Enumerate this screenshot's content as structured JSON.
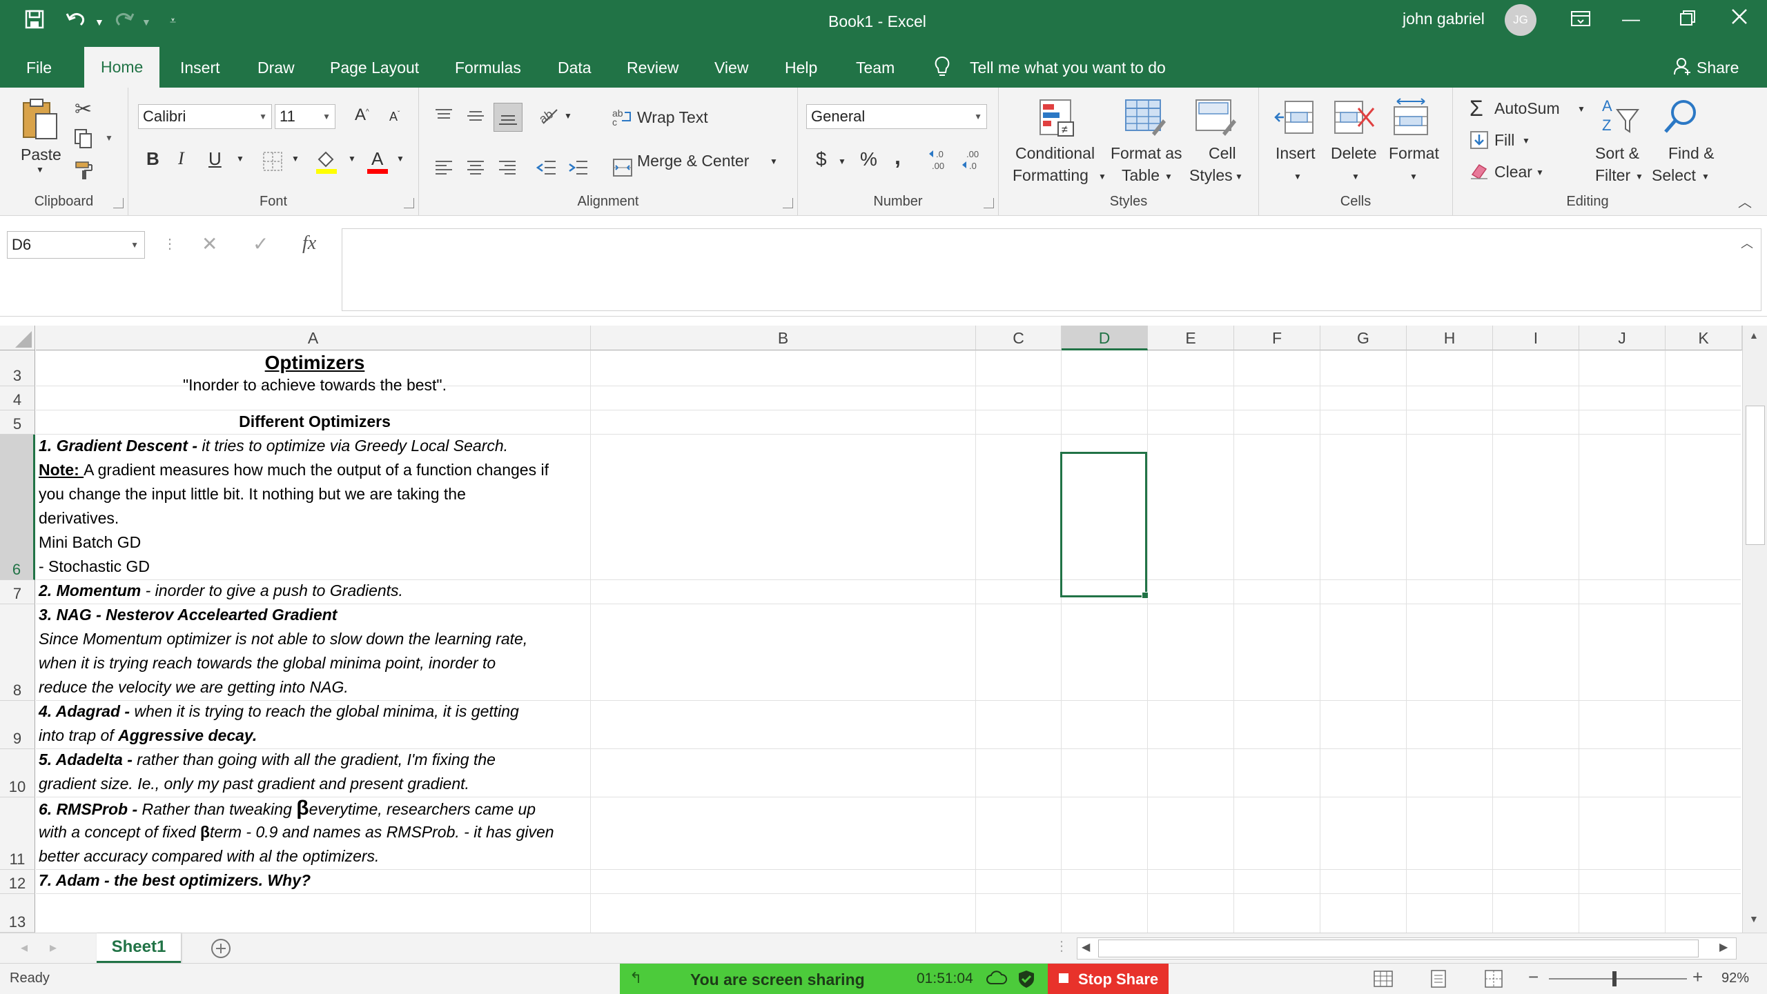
{
  "window": {
    "title": "Book1  -  Excel",
    "user": "john gabriel",
    "user_initials": "JG"
  },
  "tabs": [
    "File",
    "Home",
    "Insert",
    "Draw",
    "Page Layout",
    "Formulas",
    "Data",
    "Review",
    "View",
    "Help",
    "Team"
  ],
  "tell_me": "Tell me what you want to do",
  "share": "Share",
  "ribbon": {
    "clipboard": {
      "paste": "Paste",
      "label": "Clipboard"
    },
    "font": {
      "name": "Calibri",
      "size": "11",
      "label": "Font",
      "bold": "B",
      "italic": "I",
      "underline": "U"
    },
    "alignment": {
      "wrap": "Wrap Text",
      "merge": "Merge & Center",
      "label": "Alignment"
    },
    "number": {
      "format": "General",
      "currency": "$",
      "percent": "%",
      "comma": ",",
      "inc_dec": ".00",
      "label": "Number"
    },
    "styles": {
      "cond1": "Conditional",
      "cond2": "Formatting",
      "fmt1": "Format as",
      "fmt2": "Table",
      "cell1": "Cell",
      "cell2": "Styles",
      "label": "Styles"
    },
    "cells": {
      "insert": "Insert",
      "delete": "Delete",
      "format": "Format",
      "label": "Cells"
    },
    "editing": {
      "autosum": "AutoSum",
      "fill": "Fill",
      "clear": "Clear",
      "sort1": "Sort &",
      "sort2": "Filter",
      "find1": "Find &",
      "find2": "Select",
      "label": "Editing"
    }
  },
  "formula_bar": {
    "name_box": "D6",
    "fx": "fx",
    "value": ""
  },
  "columns": [
    "A",
    "B",
    "C",
    "D",
    "E",
    "F",
    "G",
    "H",
    "I",
    "J",
    "K"
  ],
  "rows": [
    "3",
    "4",
    "5",
    "6",
    "7",
    "8",
    "9",
    "10",
    "11",
    "12",
    "13"
  ],
  "cells": {
    "a2": "Optimizers",
    "a3": "\"Inorder to achieve towards the best\".",
    "a5": "Different Optimizers",
    "a6_l1_b": "1. Gradient Descent - ",
    "a6_l1": " it tries to optimize via Greedy Local Search.",
    "a6_l2_b": "Note: ",
    "a6_l2": "A gradient measures how much the output of a function changes if",
    "a6_l3": "you change the input little bit. It nothing but we are taking the",
    "a6_l4": "derivatives.",
    "a6_l5": " Mini Batch GD",
    "a6_l6": "- Stochastic GD",
    "a7_b": "2. Momentum ",
    "a7": " - inorder to give a push to Gradients.",
    "a8_l1": "3. NAG - Nesterov Accelearted Gradient",
    "a8_l2": "Since Momentum optimizer is not able to slow down the learning rate,",
    "a8_l3": "when it is trying reach towards the global minima point, inorder to",
    "a8_l4": "reduce the velocity we are getting into NAG.",
    "a9_b": "4. Adagrad - ",
    "a9_l1": " when it is trying to reach the global minima, it is getting",
    "a9_l2": "into trap of ",
    "a9_l2_b": "Aggressive decay.",
    "a10_b": "5. Adadelta - ",
    "a10_l1": " rather than going with all the gradient, I'm fixing the",
    "a10_l2": "gradient size. Ie., only my past gradient and present gradient.",
    "a11_b": "6. RMSProb - ",
    "a11_l1": " Rather than tweaking ",
    "a11_l1_rest": "everytime, researchers came up",
    "a11_l2": "with a concept of fixed ",
    "a11_l2_rest": "term - 0.9 and names as RMSProb. - it has given",
    "a11_l3": "better accuracy compared with al the optimizers.",
    "a12": "7. Adam - the best optimizers. Why?",
    "beta": "β"
  },
  "sheet_tab": "Sheet1",
  "status": {
    "ready": "Ready",
    "sharing": "You are screen sharing",
    "timer": "01:51:04",
    "stop": "Stop Share",
    "zoom": "92%"
  }
}
